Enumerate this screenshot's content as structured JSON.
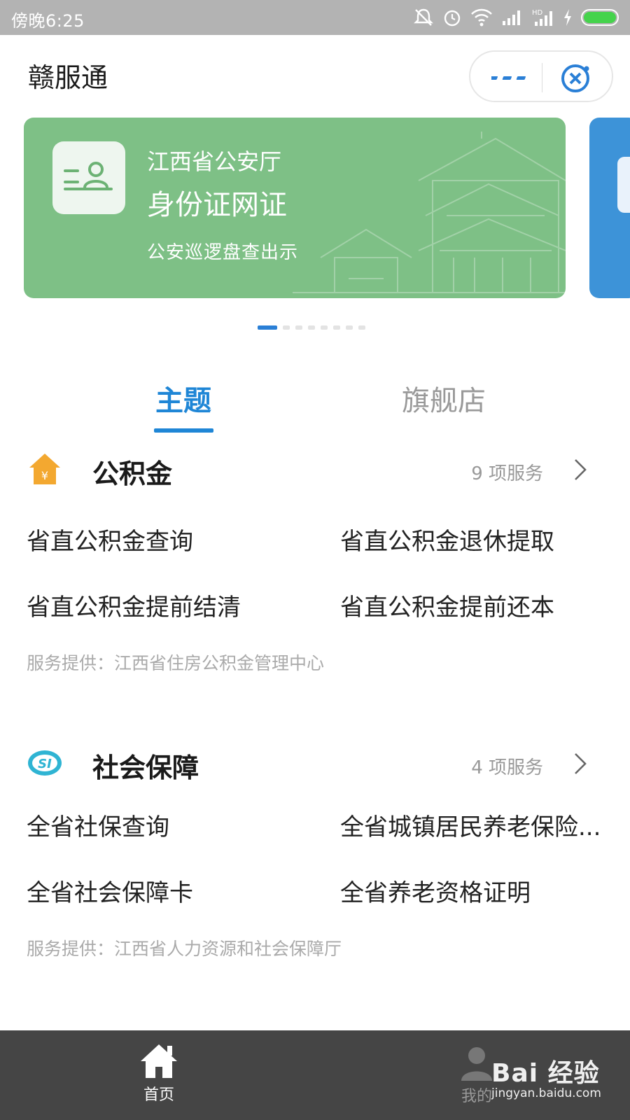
{
  "status_bar": {
    "time": "傍晚6:25"
  },
  "header": {
    "title": "赣服通"
  },
  "carousel": {
    "cards": [
      {
        "org": "江西省公安厅",
        "service": "身份证网证",
        "description": "公安巡逻盘查出示",
        "color": "#7ec086"
      }
    ],
    "next_card_color": "#3d93d8",
    "page_count": 9,
    "active_index": 0
  },
  "tabs": [
    {
      "label": "主题",
      "active": true
    },
    {
      "label": "旗舰店",
      "active": false
    }
  ],
  "sections": [
    {
      "title": "公积金",
      "icon": "house-yuan-icon",
      "count_label": "9 项服务",
      "items": [
        "省直公积金查询",
        "省直公积金退休提取",
        "省直公积金提前结清",
        "省直公积金提前还本"
      ],
      "provider": "服务提供：江西省住房公积金管理中心"
    },
    {
      "title": "社会保障",
      "icon": "si-logo-icon",
      "count_label": "4 项服务",
      "items": [
        "全省社保查询",
        "全省城镇居民养老保险...",
        "全省社会保障卡",
        "全省养老资格证明"
      ],
      "provider": "服务提供：江西省人力资源和社会保障厅"
    }
  ],
  "bottom_nav": {
    "home_label": "首页",
    "mine_label": "我的"
  },
  "watermark": {
    "brand": "Bai 经验",
    "url": "jingyan.baidu.com"
  },
  "colors": {
    "accent": "#1f86d6",
    "status_bar": "#b3b3b3",
    "bottom_bar": "#454545"
  }
}
